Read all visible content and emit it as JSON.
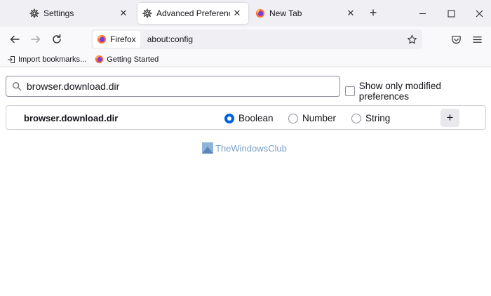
{
  "tabs": [
    {
      "label": "Settings",
      "icon": "gear-icon",
      "active": false
    },
    {
      "label": "Advanced Preferences",
      "icon": "gear-icon",
      "active": true
    },
    {
      "label": "New Tab",
      "icon": "firefox-icon",
      "active": false
    }
  ],
  "navbar": {
    "identity_label": "Firefox",
    "url": "about:config"
  },
  "bookmarks": [
    {
      "label": "Import bookmarks...",
      "icon": "import-icon"
    },
    {
      "label": "Getting Started",
      "icon": "firefox-icon"
    }
  ],
  "config": {
    "search_value": "browser.download.dir",
    "show_modified_label": "Show only modified preferences",
    "pref_name": "browser.download.dir",
    "types": [
      {
        "label": "Boolean",
        "checked": true
      },
      {
        "label": "Number",
        "checked": false
      },
      {
        "label": "String",
        "checked": false
      }
    ],
    "add_label": "+"
  },
  "watermark": "TheWindowsClub",
  "colors": {
    "accent": "#0061e0",
    "tabstrip_bg": "#f0f0f4",
    "toolbar_bg": "#f9f9fb"
  }
}
